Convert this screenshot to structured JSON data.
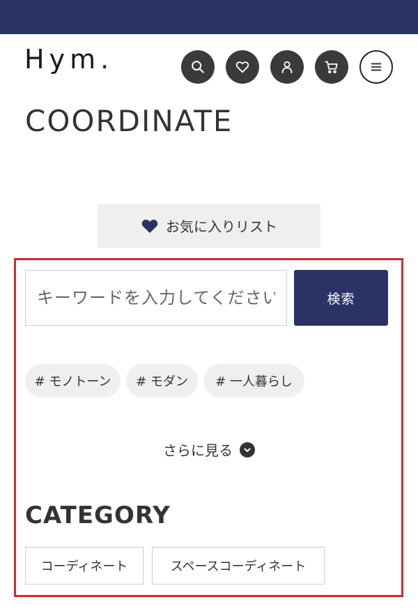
{
  "header": {
    "logo_text": "Hym.",
    "icons": [
      "search-icon",
      "heart-icon",
      "user-icon",
      "cart-icon",
      "menu-icon"
    ]
  },
  "page": {
    "title": "COORDINATE"
  },
  "favorite": {
    "label": "お気に入りリスト"
  },
  "search": {
    "placeholder": "キーワードを入力してください",
    "button_label": "検索"
  },
  "tags": [
    {
      "label": "# モノトーン"
    },
    {
      "label": "# モダン"
    },
    {
      "label": "# 一人暮らし"
    }
  ],
  "more": {
    "label": "さらに見る"
  },
  "category": {
    "title": "CATEGORY",
    "items": [
      {
        "label": "コーディネート"
      },
      {
        "label": "スペースコーディネート"
      }
    ]
  },
  "colors": {
    "brand_navy": "#2b3264",
    "icon_dark": "#3a3a3a",
    "highlight_red": "#d32a2a",
    "chip_bg": "#efefef"
  }
}
